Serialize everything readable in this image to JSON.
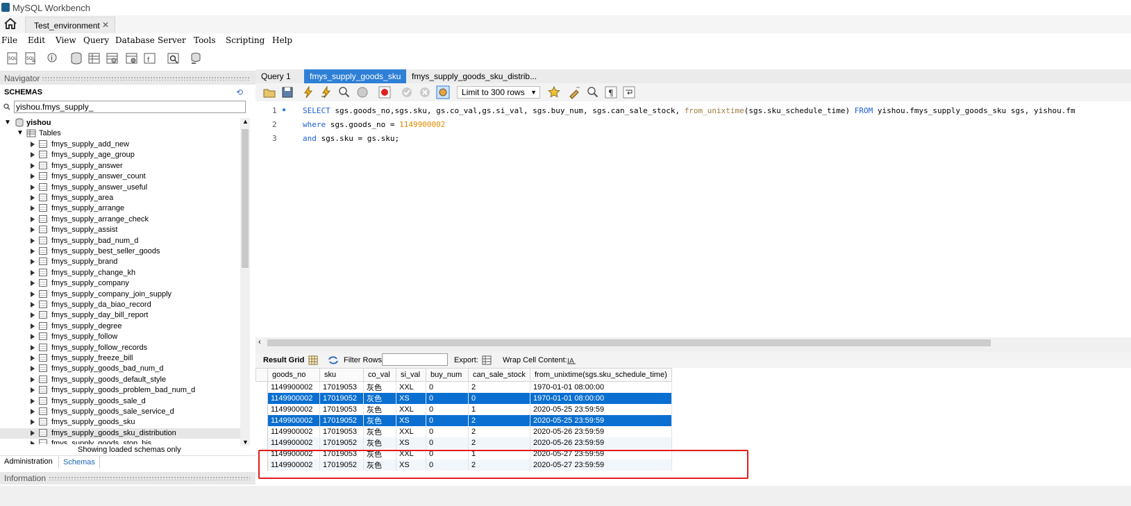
{
  "window": {
    "title": "MySQL Workbench"
  },
  "connection_tab": {
    "label": "Test_environment"
  },
  "menu": [
    "File",
    "Edit",
    "View",
    "Query",
    "Database",
    "Server",
    "Tools",
    "Scripting",
    "Help"
  ],
  "navigator": {
    "header": "Navigator",
    "schemas_label": "SCHEMAS",
    "search_value": "yishou.fmys_supply_",
    "schema_name": "yishou",
    "tables_label": "Tables",
    "tables": [
      "fmys_supply_add_new",
      "fmys_supply_age_group",
      "fmys_supply_answer",
      "fmys_supply_answer_count",
      "fmys_supply_answer_useful",
      "fmys_supply_area",
      "fmys_supply_arrange",
      "fmys_supply_arrange_check",
      "fmys_supply_assist",
      "fmys_supply_bad_num_d",
      "fmys_supply_best_seller_goods",
      "fmys_supply_brand",
      "fmys_supply_change_kh",
      "fmys_supply_company",
      "fmys_supply_company_join_supply",
      "fmys_supply_da_biao_record",
      "fmys_supply_day_bill_report",
      "fmys_supply_degree",
      "fmys_supply_follow",
      "fmys_supply_follow_records",
      "fmys_supply_freeze_bill",
      "fmys_supply_goods_bad_num_d",
      "fmys_supply_goods_default_style",
      "fmys_supply_goods_problem_bad_num_d",
      "fmys_supply_goods_sale_d",
      "fmys_supply_goods_sale_service_d",
      "fmys_supply_goods_sku",
      "fmys_supply_goods_sku_distribution",
      "fmys_supply_goods_stop_his"
    ],
    "selected_table": "fmys_supply_goods_sku_distribution",
    "loaded_message": "Showing loaded schemas only",
    "tab_admin": "Administration",
    "tab_schemas": "Schemas",
    "info_header": "Information"
  },
  "editor_tabs": [
    {
      "label": "Query 1"
    },
    {
      "label": "fmys_supply_goods_sku"
    },
    {
      "label": "fmys_supply_goods_sku_distrib..."
    }
  ],
  "editor_toolbar": {
    "limit_label": "Limit to 300 rows"
  },
  "code": {
    "line_numbers": [
      "1",
      "2",
      "3"
    ],
    "l1_kw1": "SELECT",
    "l1_part1": " sgs.goods_no,sgs.sku, gs.co_val,gs.si_val, sgs.buy_num, sgs.can_sale_stock, ",
    "l1_fn": "from_unixtime",
    "l1_part2": "(sgs.sku_schedule_time) ",
    "l1_kw2": "FROM",
    "l1_part3": " yishou.fmys_supply_goods_sku sgs, yishou.fm",
    "l2_kw": "where",
    "l2_part": " sgs.goods_no = ",
    "l2_num": "1149900002",
    "l3_kw": "and",
    "l3_part": " sgs.sku = gs.sku;"
  },
  "result_toolbar": {
    "result_grid": "Result Grid",
    "filter_rows": "Filter Rows:",
    "export": "Export:",
    "wrap": "Wrap Cell Content:"
  },
  "results": {
    "columns": [
      "goods_no",
      "sku",
      "co_val",
      "si_val",
      "buy_num",
      "can_sale_stock",
      "from_unixtime(sgs.sku_schedule_time)"
    ],
    "rows": [
      [
        "1149900002",
        "17019053",
        "灰色",
        "XXL",
        "0",
        "2",
        "1970-01-01 08:00:00"
      ],
      [
        "1149900002",
        "17019052",
        "灰色",
        "XS",
        "0",
        "0",
        "1970-01-01 08:00:00"
      ],
      [
        "1149900002",
        "17019053",
        "灰色",
        "XXL",
        "0",
        "1",
        "2020-05-25 23:59:59"
      ],
      [
        "1149900002",
        "17019052",
        "灰色",
        "XS",
        "0",
        "2",
        "2020-05-25 23:59:59"
      ],
      [
        "1149900002",
        "17019053",
        "灰色",
        "XXL",
        "0",
        "2",
        "2020-05-26 23:59:59"
      ],
      [
        "1149900002",
        "17019052",
        "灰色",
        "XS",
        "0",
        "2",
        "2020-05-26 23:59:59"
      ],
      [
        "1149900002",
        "17019053",
        "灰色",
        "XXL",
        "0",
        "1",
        "2020-05-27 23:59:59"
      ],
      [
        "1149900002",
        "17019052",
        "灰色",
        "XS",
        "0",
        "2",
        "2020-05-27 23:59:59"
      ]
    ],
    "selected_rows": [
      1,
      3
    ],
    "current_row": 3
  },
  "colors": {
    "accent": "#2e7fd6",
    "selection": "#0a6fd0",
    "highlight_box": "#e31b1b"
  }
}
